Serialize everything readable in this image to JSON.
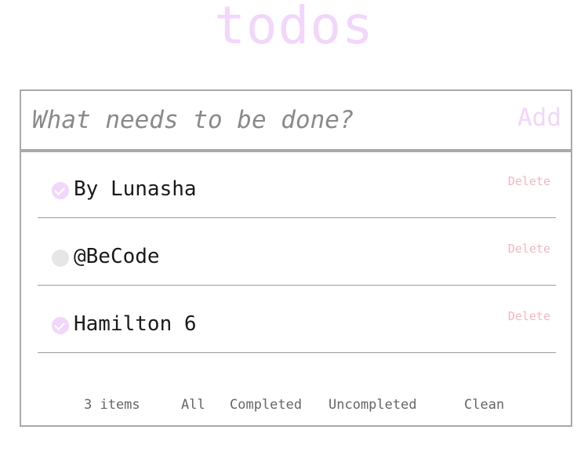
{
  "app_title": "todos",
  "input": {
    "placeholder": "What needs to be done?",
    "value": "",
    "add_label": "Add"
  },
  "todos": [
    {
      "label": "By Lunasha",
      "completed": true,
      "delete_label": "Delete"
    },
    {
      "label": "@BeCode",
      "completed": false,
      "delete_label": "Delete"
    },
    {
      "label": "Hamilton 6",
      "completed": true,
      "delete_label": "Delete"
    }
  ],
  "footer": {
    "count": "3 items",
    "filters": {
      "all": "All",
      "completed": "Completed",
      "uncompleted": "Uncompleted"
    },
    "clean_label": "Clean"
  },
  "colors": {
    "accent": "#f2d6fb",
    "delete": "#f5b6bf",
    "border": "#a9a9a9",
    "unchecked": "#e6e6e6"
  }
}
